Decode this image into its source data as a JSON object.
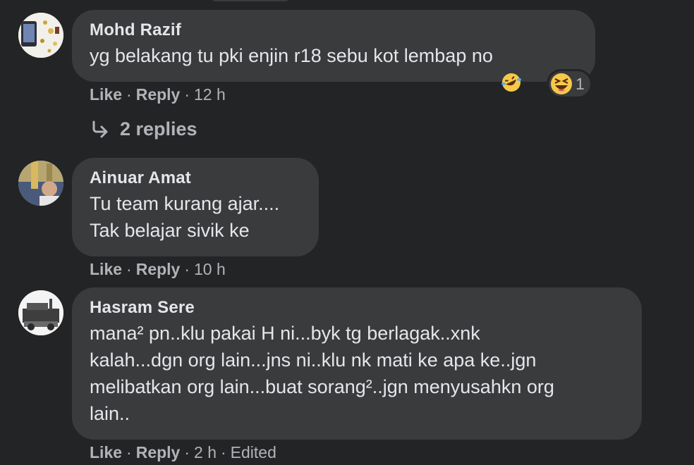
{
  "comments": [
    {
      "author": "Mohd Razif",
      "text": "yg belakang tu pki enjin r18 sebu kot lembap no",
      "like": "Like",
      "reply": "Reply",
      "time": "12 h",
      "reaction": {
        "icon": "haha-emoji-icon",
        "count": "1"
      },
      "replies_label": "2 replies"
    },
    {
      "author": "Ainuar Amat",
      "text": "Tu team kurang ajar....\nTak belajar sivik ke",
      "like": "Like",
      "reply": "Reply",
      "time": "10 h"
    },
    {
      "author": "Hasram Sere",
      "text": "mana² pn..klu pakai H ni...byk tg berlagak..xnk\nkalah...dgn org lain...jns ni..klu nk mati ke apa ke..jgn\nmelibatkan org lain...buat sorang²..jgn menyusahkn org\nlain..",
      "like": "Like",
      "reply": "Reply",
      "time": "2 h",
      "edited": "Edited"
    }
  ],
  "colors": {
    "background": "#232426",
    "bubble": "#3a3b3c",
    "primary_text": "#e4e6eb",
    "secondary_text": "#b0b3b8",
    "emoji": "#f7c94a"
  }
}
